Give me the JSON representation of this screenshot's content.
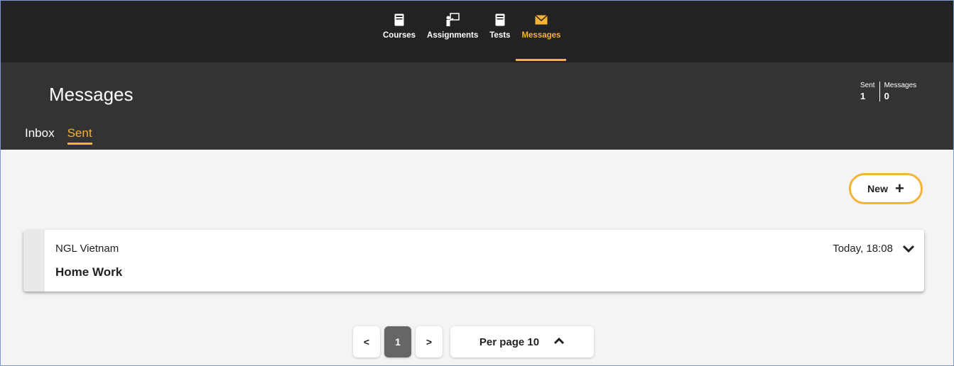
{
  "nav": {
    "items": [
      {
        "label": "Courses",
        "icon": "book-icon"
      },
      {
        "label": "Assignments",
        "icon": "presentation-icon"
      },
      {
        "label": "Tests",
        "icon": "document-icon"
      },
      {
        "label": "Messages",
        "icon": "envelope-icon",
        "active": true
      }
    ]
  },
  "header": {
    "title": "Messages",
    "tabs": [
      {
        "label": "Inbox"
      },
      {
        "label": "Sent",
        "active": true
      }
    ],
    "stats": [
      {
        "label": "Sent",
        "value": "1"
      },
      {
        "label": "Messages",
        "value": "0"
      }
    ]
  },
  "toolbar": {
    "new_label": "New",
    "new_icon": "plus-icon"
  },
  "messages": [
    {
      "sender": "NGL Vietnam",
      "subject": "Home Work",
      "date": "Today, 18:08"
    }
  ],
  "pagination": {
    "prev": "<",
    "current": "1",
    "next": ">",
    "per_page_label": "Per page 10"
  },
  "colors": {
    "accent": "#f5b335",
    "nav_bg": "#222222",
    "header_bg": "#333333"
  }
}
